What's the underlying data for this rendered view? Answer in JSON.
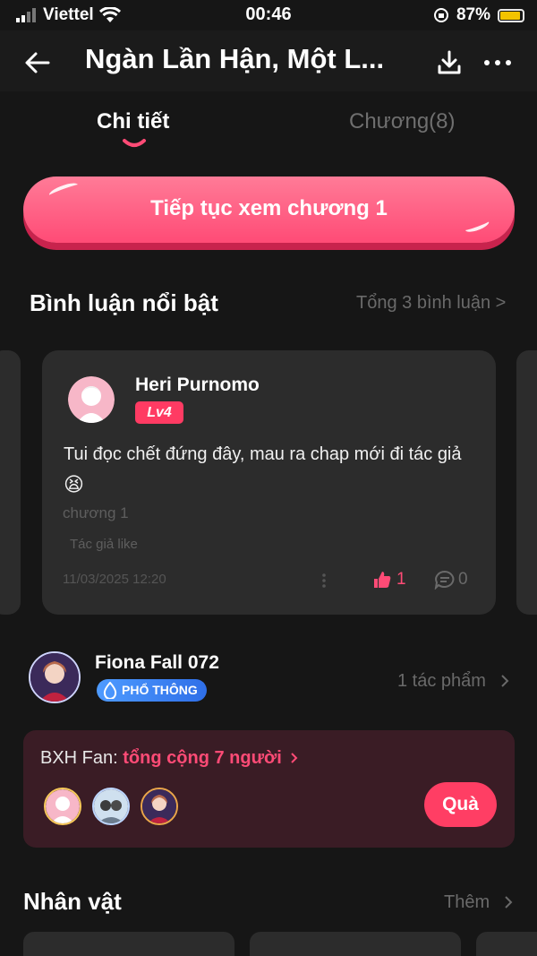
{
  "status_bar": {
    "carrier": "Viettel",
    "time": "00:46",
    "battery": "87%"
  },
  "header": {
    "title": "Ngàn Lần Hận, Một L..."
  },
  "tabs": [
    {
      "label": "Chi tiết"
    },
    {
      "label": "Chương(8)"
    }
  ],
  "continue_button": {
    "label": "Tiếp tục xem chương 1"
  },
  "featured_comments": {
    "title": "Bình luận nổi bật",
    "total_link": "Tổng 3 bình luận >",
    "comment": {
      "username": "Heri Purnomo",
      "level": "Lv4",
      "text": "Tui đọc chết đứng đây, mau ra chap mới đi tác giả",
      "emoji": "😫",
      "chapter": "chương 1",
      "author_like": "Tác giả like",
      "timestamp": "11/03/2025 12:20",
      "likes": "1",
      "replies": "0"
    }
  },
  "author": {
    "name": "Fiona Fall 072",
    "badge": "PHỔ THÔNG",
    "works_link": "1 tác phẩm"
  },
  "fan_ranking": {
    "label": "BXH Fan:",
    "count_link": "tổng cộng 7 người",
    "gift_button": "Quà"
  },
  "characters": {
    "title": "Nhân vật",
    "more_link": "Thêm"
  },
  "colors": {
    "accent": "#ff4b76",
    "background": "#161616",
    "card": "#2c2c2c",
    "fan_box": "#3a1c25"
  },
  "icons": [
    "back-arrow-icon",
    "download-icon",
    "more-dots-icon",
    "thumb-up-icon",
    "comment-icon",
    "chevron-right-icon",
    "wifi-icon",
    "signal-icon",
    "battery-icon",
    "lock-rotation-icon"
  ]
}
